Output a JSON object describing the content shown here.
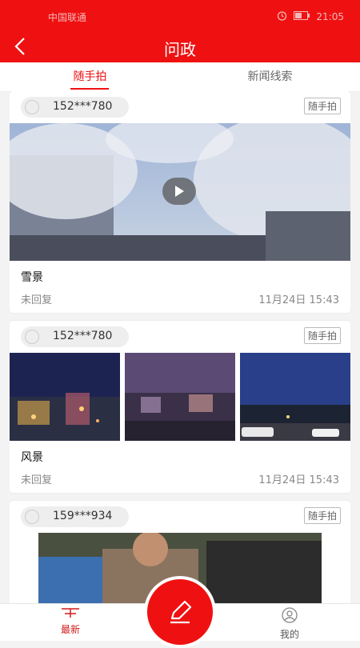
{
  "status_bar": {
    "carrier": "中国联通",
    "time": "21:05",
    "icons": [
      "signal-icon",
      "alarm-icon",
      "battery-icon"
    ]
  },
  "nav": {
    "title": "问政",
    "back_icon": "back-arrow-icon"
  },
  "tabs": [
    {
      "label": "随手拍",
      "active": true
    },
    {
      "label": "新闻线索",
      "active": false
    }
  ],
  "posts": [
    {
      "user": "152***780",
      "tag": "随手拍",
      "title": "雪景",
      "status": "未回复",
      "time": "11月24日 15:43",
      "media_type": "video"
    },
    {
      "user": "152***780",
      "tag": "随手拍",
      "title": "风景",
      "status": "未回复",
      "time": "11月24日 15:43",
      "media_type": "images"
    },
    {
      "user": "159***934",
      "tag": "随手拍",
      "media_type": "image"
    }
  ],
  "bottom_nav": {
    "latest_label": "最新",
    "mine_label": "我的",
    "compose_icon": "pencil-icon"
  },
  "colors": {
    "brand_red": "#ef1111",
    "active_tab": "#e11111"
  }
}
